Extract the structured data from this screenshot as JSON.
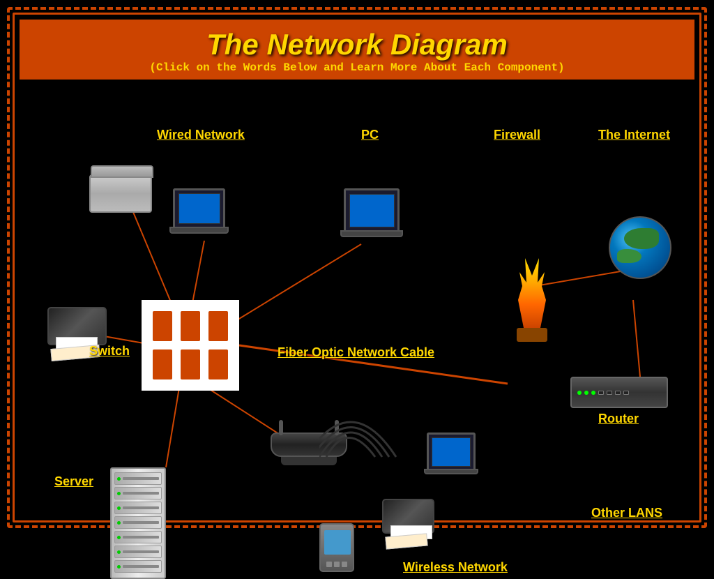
{
  "title": "The Network Diagram",
  "subtitle": "(Click on the Words Below and Learn More About Each Component)",
  "labels": {
    "wired_network": "Wired Network",
    "pc": "PC",
    "firewall": "Firewall",
    "the_internet": "The Internet",
    "switch": "Switch",
    "fiber_optic": "Fiber Optic Network Cable",
    "router": "Router",
    "server": "Server",
    "wireless_network": "Wireless Network",
    "other_lans": "Other LANS"
  },
  "colors": {
    "background": "#000000",
    "header_bg": "#cc4400",
    "title_color": "#FFD700",
    "label_color": "#FFD700",
    "border_color": "#cc4400",
    "line_color": "#cc4400"
  }
}
